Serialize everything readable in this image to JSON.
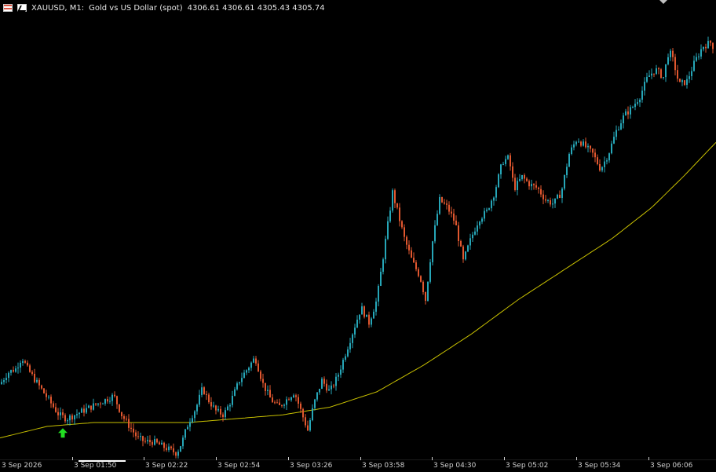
{
  "header": {
    "symbol": "XAUUSD, M1:",
    "description": "Gold vs US Dollar (spot)",
    "ohlc": "4306.61 4306.61 4305.43 4305.74",
    "icons": [
      "flag-icon",
      "gold-icon"
    ]
  },
  "colors": {
    "background": "#000000",
    "bull": "#26a6b7",
    "bear": "#e1572f",
    "ma": "#c8c000",
    "signal_arrow": "#22e022",
    "text": "#e6e6e6"
  },
  "time_axis": {
    "labels": [
      "3 Sep 2026",
      "3 Sep 01:50",
      "3 Sep 02:22",
      "3 Sep 02:54",
      "3 Sep 03:26",
      "3 Sep 03:58",
      "3 Sep 04:30",
      "3 Sep 05:02",
      "3 Sep 05:34",
      "3 Sep 06:06"
    ]
  },
  "chart_data": {
    "type": "candlestick",
    "symbol": "XAUUSD",
    "timeframe": "M1",
    "price_trend": [
      [
        0,
        4262.0
      ],
      [
        10,
        4263.5
      ],
      [
        20,
        4264.0
      ],
      [
        28,
        4265.5
      ],
      [
        35,
        4264.0
      ],
      [
        45,
        4262.5
      ],
      [
        55,
        4261.0
      ],
      [
        65,
        4259.5
      ],
      [
        75,
        4258.0
      ],
      [
        85,
        4257.5
      ],
      [
        95,
        4258.0
      ],
      [
        105,
        4258.5
      ],
      [
        115,
        4259.0
      ],
      [
        125,
        4259.5
      ],
      [
        135,
        4260.0
      ],
      [
        145,
        4260.5
      ],
      [
        155,
        4258.0
      ],
      [
        165,
        4256.5
      ],
      [
        175,
        4255.0
      ],
      [
        185,
        4254.5
      ],
      [
        195,
        4254.5
      ],
      [
        205,
        4254.0
      ],
      [
        215,
        4253.5
      ],
      [
        225,
        4253.0
      ],
      [
        232,
        4254.5
      ],
      [
        240,
        4257.0
      ],
      [
        250,
        4259.0
      ],
      [
        258,
        4261.5
      ],
      [
        265,
        4260.0
      ],
      [
        275,
        4258.5
      ],
      [
        285,
        4258.0
      ],
      [
        295,
        4260.0
      ],
      [
        305,
        4262.5
      ],
      [
        315,
        4264.0
      ],
      [
        325,
        4265.5
      ],
      [
        335,
        4262.0
      ],
      [
        345,
        4260.0
      ],
      [
        355,
        4259.0
      ],
      [
        365,
        4260.0
      ],
      [
        375,
        4261.0
      ],
      [
        385,
        4258.0
      ],
      [
        392,
        4256.0
      ],
      [
        400,
        4259.5
      ],
      [
        410,
        4262.5
      ],
      [
        420,
        4261.0
      ],
      [
        430,
        4263.0
      ],
      [
        440,
        4266.0
      ],
      [
        450,
        4269.0
      ],
      [
        460,
        4272.0
      ],
      [
        470,
        4270.0
      ],
      [
        480,
        4273.0
      ],
      [
        490,
        4280.0
      ],
      [
        500,
        4287.0
      ],
      [
        505,
        4285.0
      ],
      [
        515,
        4281.0
      ],
      [
        525,
        4278.0
      ],
      [
        535,
        4276.0
      ],
      [
        542,
        4273.0
      ],
      [
        550,
        4280.0
      ],
      [
        560,
        4286.0
      ],
      [
        570,
        4285.0
      ],
      [
        580,
        4283.0
      ],
      [
        590,
        4278.0
      ],
      [
        600,
        4281.0
      ],
      [
        610,
        4283.5
      ],
      [
        620,
        4284.5
      ],
      [
        630,
        4287.0
      ],
      [
        640,
        4291.0
      ],
      [
        648,
        4291.5
      ],
      [
        655,
        4287.5
      ],
      [
        665,
        4289.0
      ],
      [
        675,
        4288.0
      ],
      [
        685,
        4287.5
      ],
      [
        695,
        4286.0
      ],
      [
        705,
        4285.5
      ],
      [
        715,
        4287.0
      ],
      [
        725,
        4292.0
      ],
      [
        735,
        4294.0
      ],
      [
        745,
        4293.0
      ],
      [
        755,
        4292.0
      ],
      [
        765,
        4290.0
      ],
      [
        775,
        4292.0
      ],
      [
        785,
        4295.0
      ],
      [
        795,
        4297.0
      ],
      [
        805,
        4298.0
      ],
      [
        815,
        4299.5
      ],
      [
        825,
        4302.0
      ],
      [
        835,
        4303.0
      ],
      [
        845,
        4302.0
      ],
      [
        852,
        4305.5
      ],
      [
        858,
        4304.0
      ],
      [
        865,
        4301.0
      ],
      [
        875,
        4301.5
      ],
      [
        885,
        4304.0
      ],
      [
        895,
        4306.0
      ],
      [
        905,
        4306.5
      ],
      [
        910,
        4305.7
      ]
    ],
    "moving_average": [
      [
        0,
        4255.0
      ],
      [
        60,
        4256.5
      ],
      [
        120,
        4257.0
      ],
      [
        180,
        4257.0
      ],
      [
        240,
        4257.0
      ],
      [
        300,
        4257.5
      ],
      [
        360,
        4258.0
      ],
      [
        420,
        4259.0
      ],
      [
        480,
        4261.0
      ],
      [
        540,
        4264.5
      ],
      [
        600,
        4268.5
      ],
      [
        660,
        4273.0
      ],
      [
        720,
        4277.0
      ],
      [
        780,
        4281.0
      ],
      [
        830,
        4285.0
      ],
      [
        870,
        4289.0
      ],
      [
        912,
        4293.5
      ]
    ],
    "signals": [
      {
        "type": "buy",
        "x": 80
      }
    ],
    "ylim": [
      4252.5,
      4310.0
    ]
  }
}
